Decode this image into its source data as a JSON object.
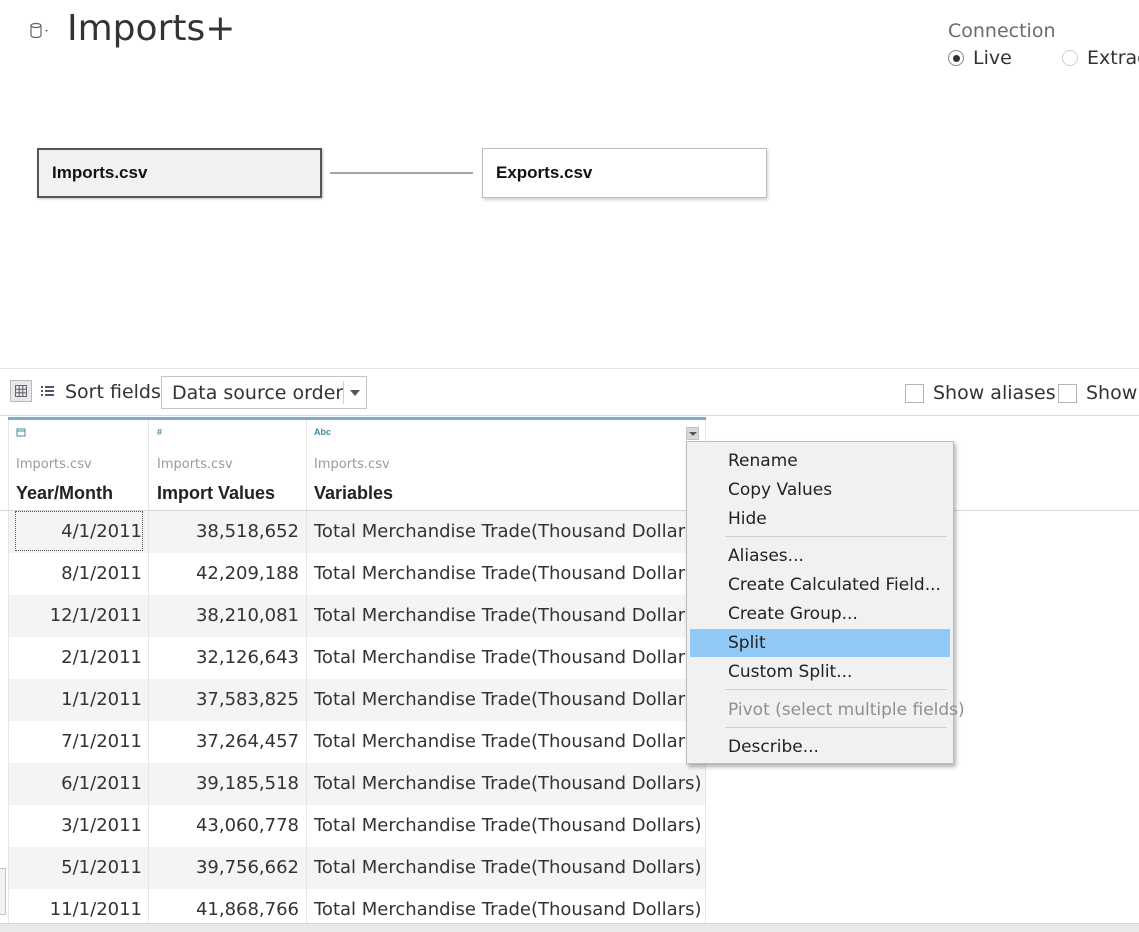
{
  "header": {
    "title": "Imports+"
  },
  "connection": {
    "label": "Connection",
    "live_label": "Live",
    "extract_label": "Extrac",
    "selected": "Live"
  },
  "join": {
    "left_table": "Imports.csv",
    "right_table": "Exports.csv"
  },
  "toolbar": {
    "sort_label": "Sort fields",
    "sort_value": "Data source order",
    "show_aliases_label": "Show aliases",
    "show_hidden_label": "Show"
  },
  "grid": {
    "columns": [
      {
        "type_icon": "calendar-icon",
        "source": "Imports.csv",
        "name": "Year/Month"
      },
      {
        "type_icon": "#",
        "source": "Imports.csv",
        "name": "Import Values"
      },
      {
        "type_icon": "Abc",
        "source": "Imports.csv",
        "name": "Variables"
      }
    ],
    "rows": [
      [
        "4/1/2011",
        "38,518,652",
        "Total Merchandise Trade(Thousand Dollars)"
      ],
      [
        "8/1/2011",
        "42,209,188",
        "Total Merchandise Trade(Thousand Dollars)"
      ],
      [
        "12/1/2011",
        "38,210,081",
        "Total Merchandise Trade(Thousand Dollars)"
      ],
      [
        "2/1/2011",
        "32,126,643",
        "Total Merchandise Trade(Thousand Dollars)"
      ],
      [
        "1/1/2011",
        "37,583,825",
        "Total Merchandise Trade(Thousand Dollars)"
      ],
      [
        "7/1/2011",
        "37,264,457",
        "Total Merchandise Trade(Thousand Dollars)"
      ],
      [
        "6/1/2011",
        "39,185,518",
        "Total Merchandise Trade(Thousand Dollars)"
      ],
      [
        "3/1/2011",
        "43,060,778",
        "Total Merchandise Trade(Thousand Dollars)"
      ],
      [
        "5/1/2011",
        "39,756,662",
        "Total Merchandise Trade(Thousand Dollars)"
      ],
      [
        "11/1/2011",
        "41,868,766",
        "Total Merchandise Trade(Thousand Dollars)"
      ]
    ]
  },
  "context_menu": {
    "items": [
      {
        "label": "Rename"
      },
      {
        "label": "Copy Values"
      },
      {
        "label": "Hide"
      },
      {
        "label": "Aliases..."
      },
      {
        "label": "Create Calculated Field..."
      },
      {
        "label": "Create Group..."
      },
      {
        "label": "Split"
      },
      {
        "label": "Custom Split..."
      },
      {
        "label": "Pivot (select multiple fields)"
      },
      {
        "label": "Describe..."
      }
    ],
    "highlighted": "Split",
    "disabled": [
      "Pivot (select multiple fields)"
    ]
  },
  "colors": {
    "accent": "#7cabd2",
    "highlight": "#91c9f7",
    "field_type": "#3b8fa3"
  }
}
